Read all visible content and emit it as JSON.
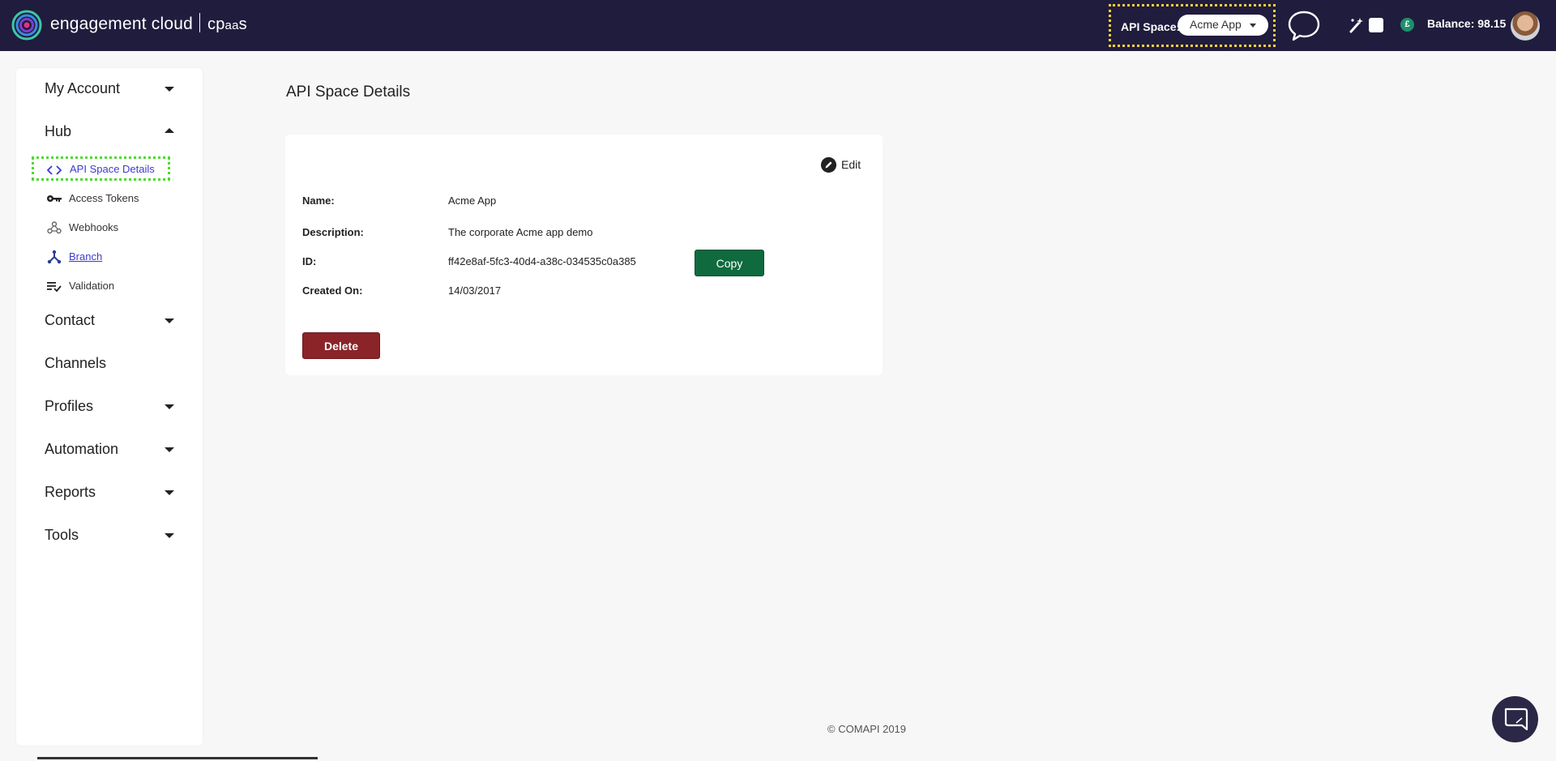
{
  "header": {
    "brand_main": "engagement cloud",
    "brand_cp": "cp",
    "brand_aa": "aa",
    "brand_s": "s",
    "api_space_label": "API Space:",
    "api_space_value": "Acme App",
    "balance": "Balance: 98.15",
    "currency_symbol": "£",
    "accent_color": "#201c3d"
  },
  "sidebar": {
    "sections": [
      {
        "label": "My Account",
        "state": "collapsed"
      },
      {
        "label": "Hub",
        "state": "expanded"
      },
      {
        "label": "Contact",
        "state": "collapsed"
      },
      {
        "label": "Channels",
        "state": "none"
      },
      {
        "label": "Profiles",
        "state": "collapsed"
      },
      {
        "label": "Automation",
        "state": "collapsed"
      },
      {
        "label": "Reports",
        "state": "collapsed"
      },
      {
        "label": "Tools",
        "state": "collapsed"
      }
    ],
    "hub_items": [
      {
        "label": "API Space Details",
        "icon": "code-icon",
        "active": true
      },
      {
        "label": "Access Tokens",
        "icon": "key-icon"
      },
      {
        "label": "Webhooks",
        "icon": "webhook-icon"
      },
      {
        "label": "Branch",
        "icon": "branch-icon"
      },
      {
        "label": "Validation",
        "icon": "validation-icon"
      }
    ]
  },
  "main": {
    "title": "API Space Details",
    "edit_label": "Edit",
    "fields": [
      {
        "label": "Name:",
        "value": "Acme App"
      },
      {
        "label": "Description:",
        "value": "The corporate Acme app demo"
      },
      {
        "label": "ID:",
        "value": "ff42e8af-5fc3-40d4-a38c-034535c0a385"
      },
      {
        "label": "Created On:",
        "value": "14/03/2017"
      }
    ],
    "copy_label": "Copy",
    "delete_label": "Delete",
    "copy_color": "#0f6a3e",
    "delete_color": "#8a2428"
  },
  "footer": {
    "text": "© COMAPI 2019"
  }
}
